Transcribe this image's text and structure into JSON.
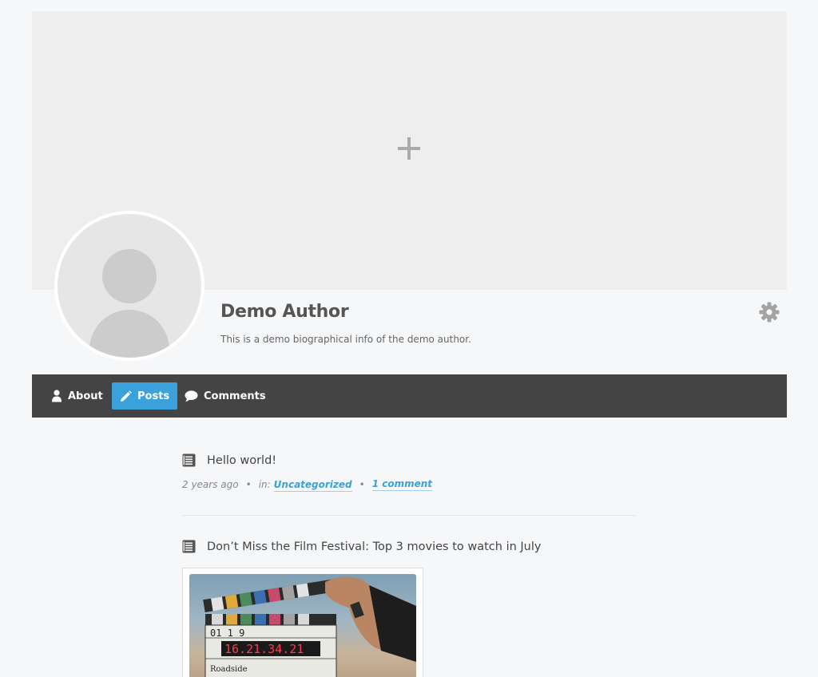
{
  "profile": {
    "name": "Demo Author",
    "bio": "This is a demo biographical info of the demo author."
  },
  "nav": {
    "items": [
      {
        "label": "About",
        "icon": "user-icon",
        "active": false
      },
      {
        "label": "Posts",
        "icon": "pencil-icon",
        "active": true
      },
      {
        "label": "Comments",
        "icon": "comment-icon",
        "active": false
      }
    ]
  },
  "posts": [
    {
      "title": "Hello world!",
      "date": "2 years ago",
      "in_label": "in:",
      "category": "Uncategorized",
      "comments": "1 comment"
    },
    {
      "title": "Don’t Miss the Film Festival: Top 3 movies to watch in July",
      "image_text": {
        "top": "01   1    9",
        "display": "16.21.34.21",
        "bottom": "Roadside"
      }
    }
  ],
  "colors": {
    "accent": "#3ba1da",
    "navbar": "#444444",
    "cover": "#eeeeee",
    "background": "#f6f7f9"
  }
}
